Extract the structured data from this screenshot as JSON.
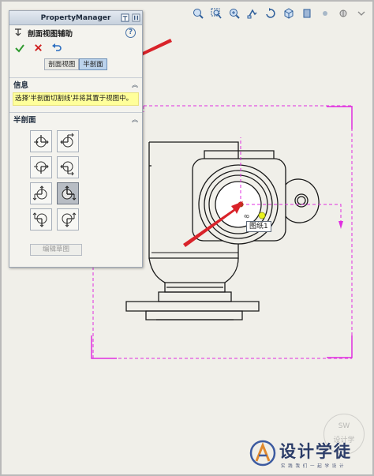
{
  "pm": {
    "title": "PropertyManager",
    "feature_title": "剖面视图辅助",
    "tabs": [
      {
        "label": "剖面视图",
        "active": false
      },
      {
        "label": "半剖面",
        "active": true
      }
    ]
  },
  "info": {
    "header": "信息",
    "message": "选择'半剖面切割线'并将其置于视图中。"
  },
  "half_section": {
    "header": "半剖面",
    "selected_index": 5,
    "edit_sketch_label": "编辑草图"
  },
  "drawing": {
    "sheet_tag": "图纸1",
    "dim_text": "8"
  },
  "watermark": {
    "title": "设计学徒",
    "subtitle": "实 践 我 们 一 起 学 设 计",
    "circle_line1": "SW",
    "circle_line2": "设计学"
  },
  "colors": {
    "accent_arrow": "#d9232a",
    "section_line": "#e02ee0",
    "info_bg": "#ffff9a",
    "active_tab": "#bcd3ec"
  },
  "icons": {
    "toolbar": [
      "zoom-fit-icon",
      "zoom-area-icon",
      "zoom-icon",
      "pan-icon",
      "rotate-icon",
      "cube-icon",
      "display-style-icon",
      "hide-show-icon",
      "appearance-icon",
      "scene-icon"
    ],
    "pm": [
      "pin-icon",
      "close-icon",
      "section-view-icon",
      "help-icon",
      "ok-check-icon",
      "cancel-x-icon",
      "undo-icon"
    ]
  }
}
